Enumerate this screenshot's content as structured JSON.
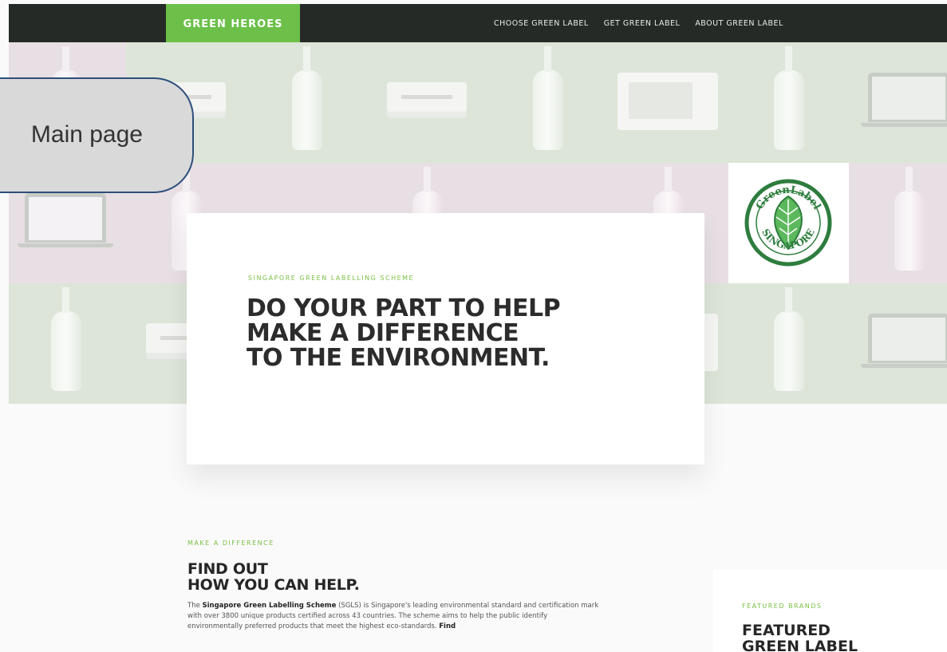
{
  "nav": {
    "brand": "GREEN HEROES",
    "links": [
      "CHOOSE GREEN LABEL",
      "GET GREEN LABEL",
      "ABOUT GREEN LABEL"
    ]
  },
  "callout": {
    "label": "Main page"
  },
  "hero": {
    "eyebrow": "SINGAPORE GREEN LABELLING SCHEME",
    "title": "DO YOUR PART TO HELP\nMAKE A DIFFERENCE\nTO THE ENVIRONMENT.",
    "logo_text": "GreenLabel SINGAPORE"
  },
  "section": {
    "eyebrow": "MAKE A DIFFERENCE",
    "title": "FIND OUT\nHOW YOU CAN HELP.",
    "para_strong": "Singapore Green Labelling Scheme",
    "para_text": " (SGLS) is Singapore's leading environmental standard and certification mark with over 3800 unique products certified across 43 countries. The scheme aims to help the public identify environmentally preferred products that meet the highest eco-standards. ",
    "para_end": "Find"
  },
  "featured": {
    "eyebrow": "FEATURED BRANDS",
    "title": "FEATURED\nGREEN LABEL PRODUCTS"
  },
  "colors": {
    "accent": "#7bc043",
    "nav_bg": "#262a26",
    "brand_bg": "#6cc04a"
  }
}
